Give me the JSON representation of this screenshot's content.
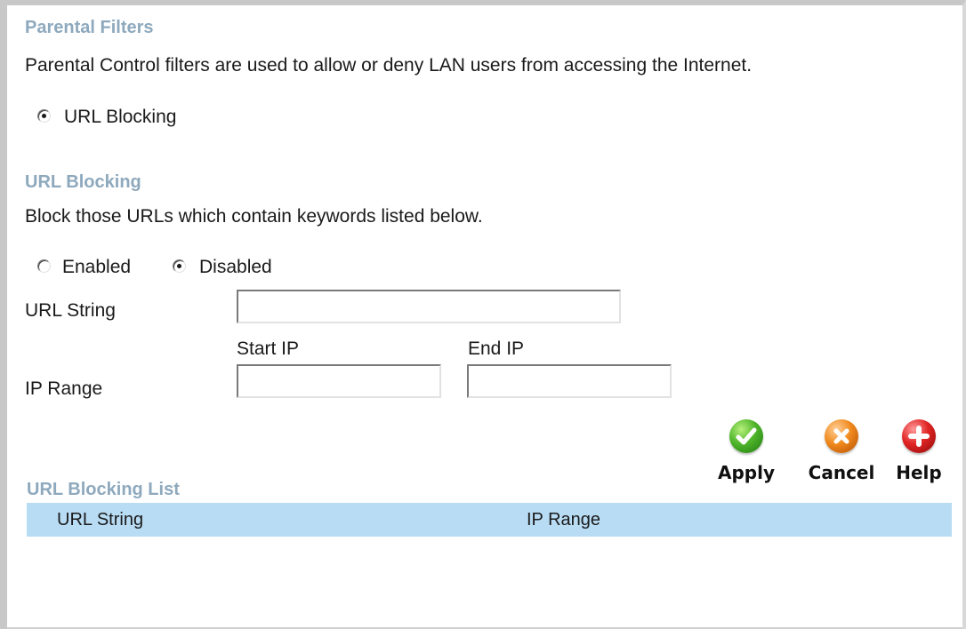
{
  "parental": {
    "title": "Parental Filters",
    "description": "Parental Control filters are used to allow or deny LAN users from accessing the Internet.",
    "mode_option": "URL Blocking",
    "mode_selected": true
  },
  "url_blocking": {
    "title": "URL Blocking",
    "description": "Block those URLs which contain keywords listed below.",
    "enabled_label": "Enabled",
    "disabled_label": "Disabled",
    "enabled_selected": false,
    "disabled_selected": true,
    "url_string_label": "URL String",
    "url_string_value": "",
    "start_ip_label": "Start IP",
    "end_ip_label": "End IP",
    "ip_range_label": "IP Range",
    "start_ip_value": "",
    "end_ip_value": ""
  },
  "actions": {
    "apply_label": "Apply",
    "cancel_label": "Cancel",
    "help_label": "Help",
    "apply_icon": "check-circle-icon",
    "cancel_icon": "x-circle-icon",
    "help_icon": "plus-circle-icon",
    "apply_color": "#4fb52a",
    "cancel_color": "#f08a1e",
    "help_color": "#e02424"
  },
  "list": {
    "title": "URL Blocking List",
    "columns": [
      "URL String",
      "IP Range"
    ],
    "header_color": "#b8dcf4",
    "rows": []
  },
  "colors": {
    "section_title": "#8ea9bd"
  }
}
